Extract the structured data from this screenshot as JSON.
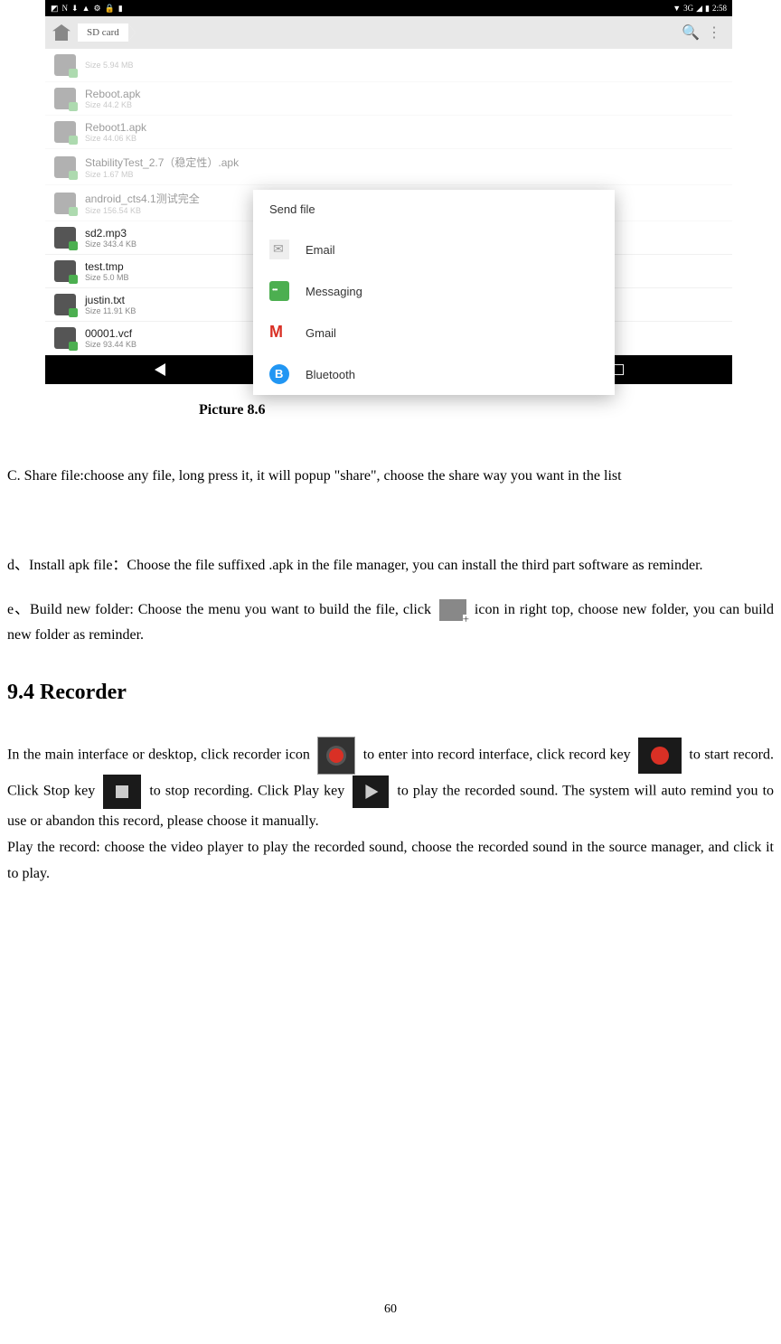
{
  "screenshot": {
    "status_bar": {
      "left_icons": [
        "◩",
        "N",
        "⬇",
        "▲",
        "⚙",
        "🔒",
        "▮"
      ],
      "signal": "3G",
      "battery": "▮",
      "time": "2:58"
    },
    "toolbar": {
      "breadcrumb": "SD card"
    },
    "files": [
      {
        "name": "",
        "size": "Size 5.94 MB",
        "dimmed": true
      },
      {
        "name": "Reboot.apk",
        "size": "Size 44.2 KB",
        "dimmed": true
      },
      {
        "name": "Reboot1.apk",
        "size": "Size 44.06 KB",
        "dimmed": true
      },
      {
        "name": "StabilityTest_2.7（稳定性）.apk",
        "size": "Size 1.67 MB",
        "dimmed": true
      },
      {
        "name": "android_cts4.1测试完全",
        "size": "Size 156.54 KB",
        "dimmed": true
      },
      {
        "name": "sd2.mp3",
        "size": "Size 343.4 KB",
        "dimmed": false
      },
      {
        "name": "test.tmp",
        "size": "Size 5.0 MB",
        "dimmed": false
      },
      {
        "name": "justin.txt",
        "size": "Size 11.91 KB",
        "dimmed": false
      },
      {
        "name": "00001.vcf",
        "size": "Size 93.44 KB",
        "dimmed": false
      }
    ],
    "dialog": {
      "title": "Send file",
      "options": [
        {
          "label": "Email",
          "icon": "email"
        },
        {
          "label": "Messaging",
          "icon": "messaging"
        },
        {
          "label": "Gmail",
          "icon": "gmail"
        },
        {
          "label": "Bluetooth",
          "icon": "bluetooth"
        }
      ]
    }
  },
  "caption": "Picture 8.6",
  "text": {
    "section_c": "C. Share file:choose any file, long press it, it will popup \"share\", choose the share way you want in the list",
    "section_d": "d、Install apk file：Choose the file suffixed .apk in the file manager, you can install the third part software as reminder.",
    "section_e_pre": "e、Build new folder: Choose the menu you want to build the file, click ",
    "section_e_post": " icon in right top, choose new folder, you can build new folder as reminder.",
    "heading": "9.4 Recorder",
    "rec_1": "In the main interface or desktop, click recorder icon ",
    "rec_2": " to enter into record interface, click record key ",
    "rec_3": " to start record. Click Stop key ",
    "rec_4": " to stop recording. Click Play key ",
    "rec_5": " to play the recorded sound. The system will auto remind you to use or abandon this record, please choose it manually.",
    "play_record": "Play the record: choose the video player to play the recorded sound, choose the recorded sound in the source manager, and click it to play."
  },
  "page_number": "60"
}
